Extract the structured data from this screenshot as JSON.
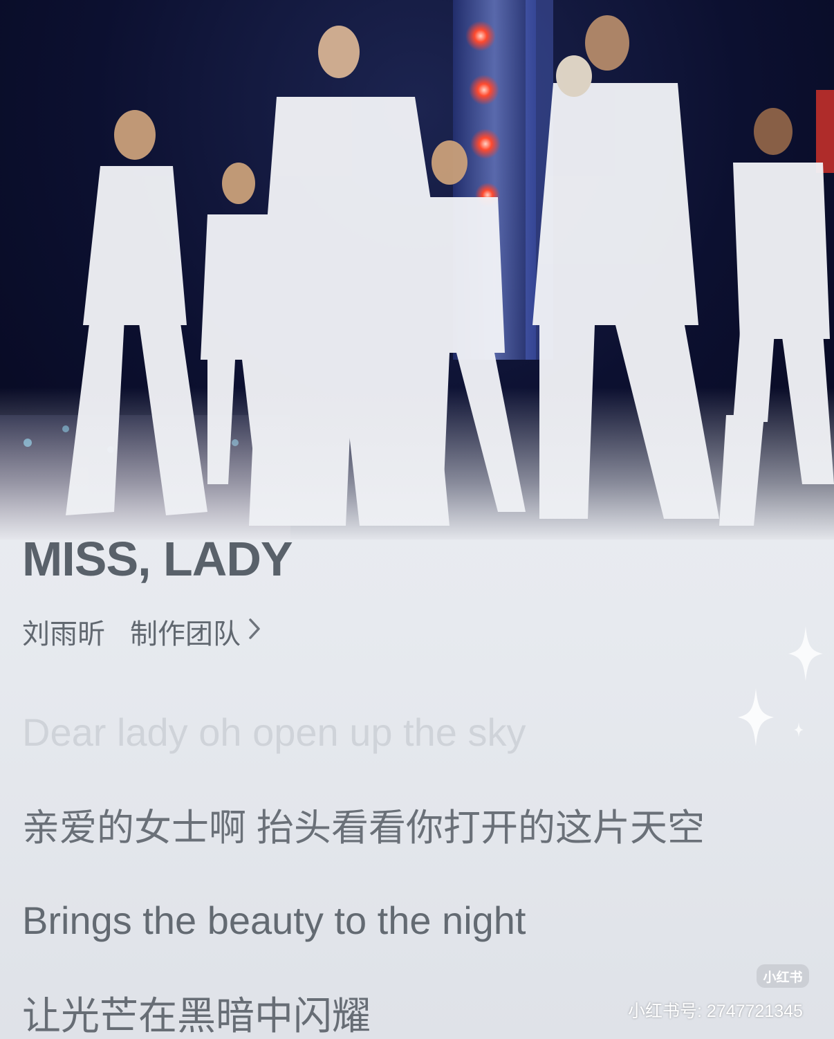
{
  "song": {
    "title": "MISS, LADY",
    "artist": "刘雨昕",
    "team_label": "制作团队"
  },
  "lyrics": [
    "Dear lady oh open up the sky",
    "亲爱的女士啊 抬头看看你打开的这片天空",
    "Brings the beauty to the night",
    "让光芒在黑暗中闪耀"
  ],
  "watermark": {
    "logo": "小红书",
    "id": "小红书号: 2747721345"
  },
  "icons": {
    "chevron": "chevron-right-icon",
    "sparkle": "sparkle-icon"
  },
  "colors": {
    "background": "#eef0f4",
    "title": "#59616a",
    "lyric_active": "#636a72",
    "lyric_dim": "#cfd3d9",
    "stage_night": "#0c1030",
    "stage_light": "#e8402e"
  }
}
